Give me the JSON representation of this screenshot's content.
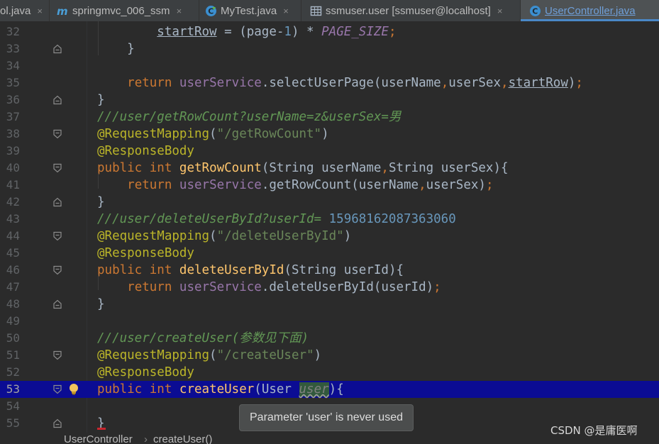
{
  "tabs": [
    {
      "label": "ol.java",
      "icon": "java-file-icon"
    },
    {
      "label": "springmvc_006_ssm",
      "icon": "maven-module-icon"
    },
    {
      "label": "MyTest.java",
      "icon": "java-test-class-icon"
    },
    {
      "label": "ssmuser.user [ssmuser@localhost]",
      "icon": "database-table-icon"
    },
    {
      "label": "UserController.java",
      "icon": "java-class-icon"
    }
  ],
  "close_glyph": "×",
  "editor": {
    "lines": [
      {
        "number": "32",
        "segments": [
          {
            "t": "        "
          },
          {
            "t": "startRow",
            "c": "u"
          },
          {
            "t": " = (page-"
          },
          {
            "t": "1",
            "c": "nm"
          },
          {
            "t": ") * "
          },
          {
            "t": "PAGE_SIZE",
            "c": "cs"
          },
          {
            "t": ";",
            "c": "kw"
          }
        ]
      },
      {
        "number": "33",
        "segments": [
          {
            "t": "    }"
          }
        ]
      },
      {
        "number": "34",
        "segments": []
      },
      {
        "number": "35",
        "segments": [
          {
            "t": "    "
          },
          {
            "t": "return",
            "c": "kw"
          },
          {
            "t": " "
          },
          {
            "t": "userService",
            "c": "fd"
          },
          {
            "t": ".selectUserPage(userName"
          },
          {
            "t": ",",
            "c": "kw"
          },
          {
            "t": "userSex"
          },
          {
            "t": ",",
            "c": "kw"
          },
          {
            "t": "startRow",
            "c": "u"
          },
          {
            "t": ")"
          },
          {
            "t": ";",
            "c": "kw"
          }
        ]
      },
      {
        "number": "36",
        "segments": [
          {
            "t": "}"
          }
        ]
      },
      {
        "number": "37",
        "segments": [
          {
            "t": "///user/getRowCount?userName=z&userSex=男",
            "c": "cm"
          }
        ]
      },
      {
        "number": "38",
        "segments": [
          {
            "t": "@RequestMapping",
            "c": "an"
          },
          {
            "t": "("
          },
          {
            "t": "\"/getRowCount\"",
            "c": "st"
          },
          {
            "t": ")"
          }
        ]
      },
      {
        "number": "39",
        "segments": [
          {
            "t": "@ResponseBody",
            "c": "an"
          }
        ]
      },
      {
        "number": "40",
        "segments": [
          {
            "t": "public",
            "c": "kw"
          },
          {
            "t": " "
          },
          {
            "t": "int",
            "c": "kw"
          },
          {
            "t": " "
          },
          {
            "t": "getRowCount",
            "c": "mt"
          },
          {
            "t": "(String userName"
          },
          {
            "t": ",",
            "c": "kw"
          },
          {
            "t": "String userSex){"
          }
        ]
      },
      {
        "number": "41",
        "segments": [
          {
            "t": "    "
          },
          {
            "t": "return",
            "c": "kw"
          },
          {
            "t": " "
          },
          {
            "t": "userService",
            "c": "fd"
          },
          {
            "t": ".getRowCount(userName"
          },
          {
            "t": ",",
            "c": "kw"
          },
          {
            "t": "userSex)"
          },
          {
            "t": ";",
            "c": "kw"
          }
        ]
      },
      {
        "number": "42",
        "segments": [
          {
            "t": "}"
          }
        ]
      },
      {
        "number": "43",
        "segments": [
          {
            "t": "///user/deleteUserById?userId= ",
            "c": "cm"
          },
          {
            "t": "15968162087363060",
            "c": "nm"
          }
        ]
      },
      {
        "number": "44",
        "segments": [
          {
            "t": "@RequestMapping",
            "c": "an"
          },
          {
            "t": "("
          },
          {
            "t": "\"/deleteUserById\"",
            "c": "st"
          },
          {
            "t": ")"
          }
        ]
      },
      {
        "number": "45",
        "segments": [
          {
            "t": "@ResponseBody",
            "c": "an"
          }
        ]
      },
      {
        "number": "46",
        "segments": [
          {
            "t": "public",
            "c": "kw"
          },
          {
            "t": " "
          },
          {
            "t": "int",
            "c": "kw"
          },
          {
            "t": " "
          },
          {
            "t": "deleteUserById",
            "c": "mt"
          },
          {
            "t": "(String userId){"
          }
        ]
      },
      {
        "number": "47",
        "segments": [
          {
            "t": "    "
          },
          {
            "t": "return",
            "c": "kw"
          },
          {
            "t": " "
          },
          {
            "t": "userService",
            "c": "fd"
          },
          {
            "t": ".deleteUserById(userId)"
          },
          {
            "t": ";",
            "c": "kw"
          }
        ]
      },
      {
        "number": "48",
        "segments": [
          {
            "t": "}"
          }
        ]
      },
      {
        "number": "49",
        "segments": []
      },
      {
        "number": "50",
        "segments": [
          {
            "t": "///user/createUser(参数见下面)",
            "c": "cm"
          }
        ]
      },
      {
        "number": "51",
        "segments": [
          {
            "t": "@RequestMapping",
            "c": "an"
          },
          {
            "t": "("
          },
          {
            "t": "\"/createUser\"",
            "c": "st"
          },
          {
            "t": ")"
          }
        ]
      },
      {
        "number": "52",
        "segments": [
          {
            "t": "@ResponseBody",
            "c": "an"
          }
        ]
      },
      {
        "number": "53",
        "segments": [
          {
            "t": "public",
            "c": "kw"
          },
          {
            "t": " "
          },
          {
            "t": "int",
            "c": "kw"
          },
          {
            "t": " "
          },
          {
            "t": "createUser",
            "c": "mt"
          },
          {
            "t": "(User "
          },
          {
            "t": "user",
            "c": "cl uhl unused"
          },
          {
            "t": "){"
          }
        ]
      },
      {
        "number": "54",
        "segments": []
      },
      {
        "number": "55",
        "segments": [
          {
            "t": "}"
          }
        ]
      }
    ]
  },
  "tooltip": {
    "text": "Parameter 'user' is never used"
  },
  "breadcrumb": {
    "items": [
      "UserController",
      "createUser()"
    ],
    "separator": "›"
  },
  "watermark": "CSDN @是庸医啊",
  "colors": {
    "keyword": "#cc7832",
    "annotation": "#bbb529",
    "string": "#6a8759",
    "doc_comment": "#629755",
    "method": "#ffc66d",
    "field": "#9876aa",
    "number": "#6897bb",
    "caret_line": "#0b0c93",
    "active_tab_underline": "#4a88c7"
  }
}
